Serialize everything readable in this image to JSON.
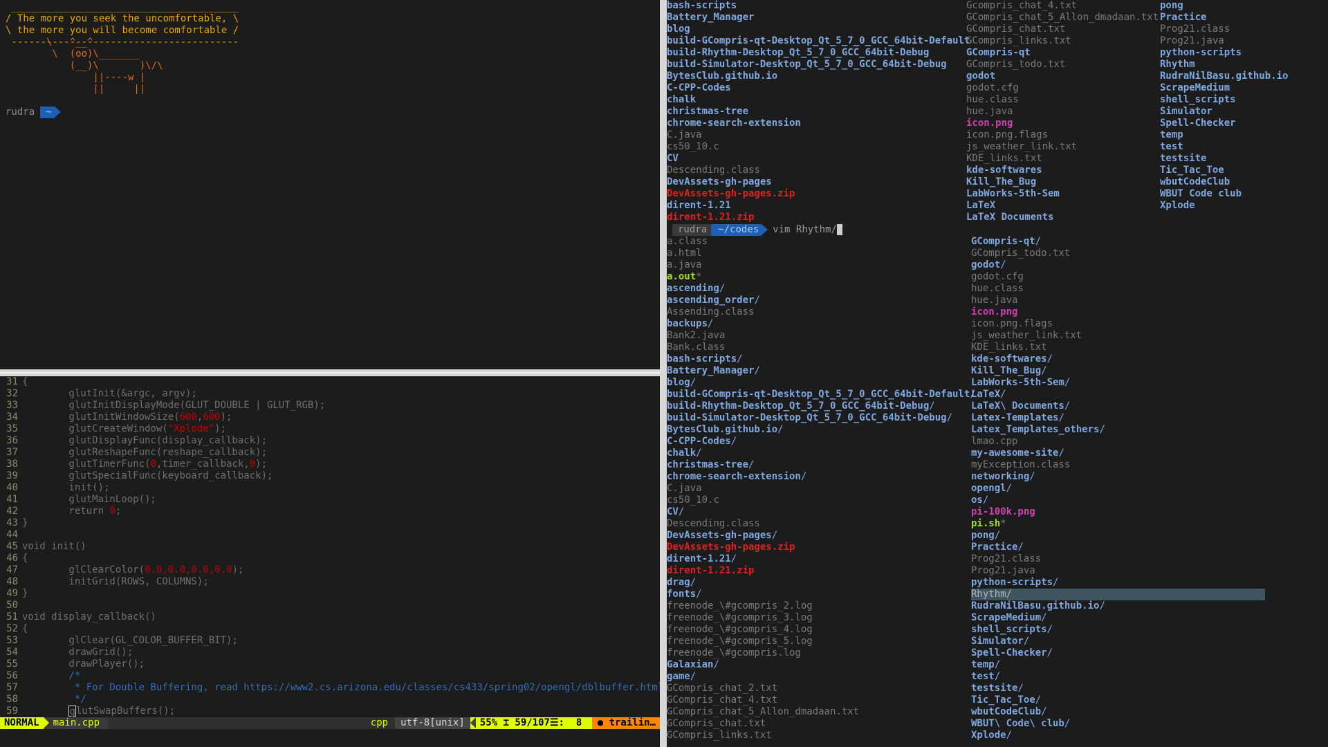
{
  "cowsay": {
    "bubble": [
      " _______________________________________",
      "/ The more you seek the uncomfortable, \\",
      "\\ the more you will become comfortable /",
      " ---------------------------------------"
    ],
    "cow": [
      "       \\   ^__^",
      "        \\  (oo)\\_______",
      "           (__)\\       )\\/\\",
      "               ||----w |",
      "               ||     ||"
    ],
    "prompt_user": "rudra",
    "prompt_dir": "~"
  },
  "vim": {
    "lines": [
      {
        "n": "31",
        "t": "{"
      },
      {
        "n": "32",
        "t": "        glutInit(&argc, argv);"
      },
      {
        "n": "33",
        "t": "        glutInitDisplayMode(GLUT_DOUBLE | GLUT_RGB);"
      },
      {
        "n": "34",
        "pre": "        glutInitWindowSize(",
        "h1": "600",
        "mid": ",",
        "h2": "600",
        "post": ");"
      },
      {
        "n": "35",
        "pre": "        glutCreateWindow(",
        "s": "\"Xplode\"",
        "post": ");"
      },
      {
        "n": "36",
        "t": "        glutDisplayFunc(display_callback);"
      },
      {
        "n": "37",
        "t": "        glutReshapeFunc(reshape_callback);"
      },
      {
        "n": "38",
        "pre": "        glutTimerFunc(",
        "h1": "0",
        "mid": ",timer_callback,",
        "h2": "0",
        "post": ");"
      },
      {
        "n": "39",
        "t": "        glutSpecialFunc(keyboard_callback);"
      },
      {
        "n": "40",
        "t": "        init();"
      },
      {
        "n": "41",
        "t": "        glutMainLoop();"
      },
      {
        "n": "42",
        "pre": "        return ",
        "h1": "0",
        "post": ";"
      },
      {
        "n": "43",
        "t": "}"
      },
      {
        "n": "44",
        "t": ""
      },
      {
        "n": "45",
        "t": "void init()"
      },
      {
        "n": "46",
        "t": "{"
      },
      {
        "n": "47",
        "pre": "        glClearColor(",
        "h1": "0.0,0.0,0.0,0.0",
        "post": ");"
      },
      {
        "n": "48",
        "t": "        initGrid(ROWS, COLUMNS);"
      },
      {
        "n": "49",
        "t": "}"
      },
      {
        "n": "50",
        "t": ""
      },
      {
        "n": "51",
        "t": "void display_callback()"
      },
      {
        "n": "52",
        "t": "{"
      },
      {
        "n": "53",
        "t": "        glClear(GL_COLOR_BUFFER_BIT);"
      },
      {
        "n": "54",
        "t": "        drawGrid();"
      },
      {
        "n": "55",
        "t": "        drawPlayer();"
      },
      {
        "n": "56",
        "c": "        /*"
      },
      {
        "n": "57",
        "c": "         * For Double Buffering, read https://www2.cs.arizona.edu/classes/cs433/spring02/opengl/dblbuffer.html"
      },
      {
        "n": "58",
        "c": "         */"
      },
      {
        "n": "59",
        "cur": true,
        "t": "glutSwapBuffers();"
      }
    ],
    "status": {
      "mode": "NORMAL",
      "file": "main.cpp",
      "filetype": "cpp",
      "encoding": "utf-8[unix]",
      "percent": "55%",
      "position": "59/107",
      "col": ":  8",
      "warning": "trailin…"
    }
  },
  "listing_top": {
    "col1": [
      {
        "n": "bash-scripts",
        "k": "dir"
      },
      {
        "n": "Battery_Manager",
        "k": "dir"
      },
      {
        "n": "blog",
        "k": "dir"
      },
      {
        "n": "build-GCompris-qt-Desktop_Qt_5_7_0_GCC_64bit-Default",
        "k": "dir"
      },
      {
        "n": "build-Rhythm-Desktop_Qt_5_7_0_GCC_64bit-Debug",
        "k": "dir"
      },
      {
        "n": "build-Simulator-Desktop_Qt_5_7_0_GCC_64bit-Debug",
        "k": "dir"
      },
      {
        "n": "BytesClub.github.io",
        "k": "dir"
      },
      {
        "n": "C-CPP-Codes",
        "k": "dir"
      },
      {
        "n": "chalk",
        "k": "dir"
      },
      {
        "n": "christmas-tree",
        "k": "dir"
      },
      {
        "n": "chrome-search-extension",
        "k": "dir"
      },
      {
        "n": "C.java",
        "k": "file"
      },
      {
        "n": "cs50_10.c",
        "k": "file"
      },
      {
        "n": "CV",
        "k": "dir"
      },
      {
        "n": "Descending.class",
        "k": "file"
      },
      {
        "n": "DevAssets-gh-pages",
        "k": "dir"
      },
      {
        "n": "DevAssets-gh-pages.zip",
        "k": "zip"
      },
      {
        "n": "dirent-1.21",
        "k": "dir"
      },
      {
        "n": "dirent-1.21.zip",
        "k": "zip"
      }
    ],
    "col2": [
      {
        "n": "Gcompris_chat_4.txt",
        "k": "file"
      },
      {
        "n": "GCompris_chat_5_Allon_dmadaan.txt",
        "k": "file"
      },
      {
        "n": "GCompris_chat.txt",
        "k": "file"
      },
      {
        "n": "GCompris_links.txt",
        "k": "file"
      },
      {
        "n": "GCompris-qt",
        "k": "dir"
      },
      {
        "n": "GCompris_todo.txt",
        "k": "file"
      },
      {
        "n": "godot",
        "k": "dir"
      },
      {
        "n": "godot.cfg",
        "k": "file"
      },
      {
        "n": "hue.class",
        "k": "file"
      },
      {
        "n": "hue.java",
        "k": "file"
      },
      {
        "n": "icon.png",
        "k": "img"
      },
      {
        "n": "icon.png.flags",
        "k": "file"
      },
      {
        "n": "js_weather_link.txt",
        "k": "file"
      },
      {
        "n": "KDE_links.txt",
        "k": "file"
      },
      {
        "n": "kde-softwares",
        "k": "dir"
      },
      {
        "n": "Kill_The_Bug",
        "k": "dir"
      },
      {
        "n": "LabWorks-5th-Sem",
        "k": "dir"
      },
      {
        "n": "LaTeX",
        "k": "dir"
      },
      {
        "n": "LaTeX Documents",
        "k": "dir"
      }
    ],
    "col3": [
      {
        "n": "pong",
        "k": "dir"
      },
      {
        "n": "Practice",
        "k": "dir"
      },
      {
        "n": "Prog21.class",
        "k": "file"
      },
      {
        "n": "Prog21.java",
        "k": "file"
      },
      {
        "n": "python-scripts",
        "k": "dir"
      },
      {
        "n": "Rhythm",
        "k": "dir"
      },
      {
        "n": "RudraNilBasu.github.io",
        "k": "dir"
      },
      {
        "n": "ScrapeMedium",
        "k": "dir"
      },
      {
        "n": "shell_scripts",
        "k": "dir"
      },
      {
        "n": "Simulator",
        "k": "dir"
      },
      {
        "n": "Spell-Checker",
        "k": "dir"
      },
      {
        "n": "temp",
        "k": "dir"
      },
      {
        "n": "test",
        "k": "dir"
      },
      {
        "n": "testsite",
        "k": "dir"
      },
      {
        "n": "Tic_Tac_Toe",
        "k": "dir"
      },
      {
        "n": "wbutCodeClub",
        "k": "dir"
      },
      {
        "n": "WBUT Code club",
        "k": "dir"
      },
      {
        "n": "Xplode",
        "k": "dir"
      }
    ]
  },
  "prompt2": {
    "user": "rudra",
    "dir": "~/codes",
    "cmd": "vim Rhythm/"
  },
  "listing_bottom": {
    "col1": [
      {
        "n": "a.class",
        "k": "file"
      },
      {
        "n": "a.html",
        "k": "file"
      },
      {
        "n": "a.java",
        "k": "file"
      },
      {
        "n": "a.out",
        "k": "exe",
        "s": "*"
      },
      {
        "n": "ascending",
        "k": "dir",
        "s": "/"
      },
      {
        "n": "ascending_order",
        "k": "dir",
        "s": "/"
      },
      {
        "n": "Assending.class",
        "k": "file"
      },
      {
        "n": "backups",
        "k": "dir",
        "s": "/"
      },
      {
        "n": "Bank2.java",
        "k": "file"
      },
      {
        "n": "Bank.class",
        "k": "file"
      },
      {
        "n": "bash-scripts",
        "k": "dir",
        "s": "/"
      },
      {
        "n": "Battery_Manager",
        "k": "dir",
        "s": "/"
      },
      {
        "n": "blog",
        "k": "dir",
        "s": "/"
      },
      {
        "n": "build-GCompris-qt-Desktop_Qt_5_7_0_GCC_64bit-Default",
        "k": "dir",
        "s": "/"
      },
      {
        "n": "build-Rhythm-Desktop_Qt_5_7_0_GCC_64bit-Debug",
        "k": "dir",
        "s": "/"
      },
      {
        "n": "build-Simulator-Desktop_Qt_5_7_0_GCC_64bit-Debug",
        "k": "dir",
        "s": "/"
      },
      {
        "n": "BytesClub.github.io",
        "k": "dir",
        "s": "/"
      },
      {
        "n": "C-CPP-Codes",
        "k": "dir",
        "s": "/"
      },
      {
        "n": "chalk",
        "k": "dir",
        "s": "/"
      },
      {
        "n": "christmas-tree",
        "k": "dir",
        "s": "/"
      },
      {
        "n": "chrome-search-extension",
        "k": "dir",
        "s": "/"
      },
      {
        "n": "C.java",
        "k": "file"
      },
      {
        "n": "cs50_10.c",
        "k": "file"
      },
      {
        "n": "CV",
        "k": "dir",
        "s": "/"
      },
      {
        "n": "Descending.class",
        "k": "file"
      },
      {
        "n": "DevAssets-gh-pages",
        "k": "dir",
        "s": "/"
      },
      {
        "n": "DevAssets-gh-pages.zip",
        "k": "zip"
      },
      {
        "n": "dirent-1.21",
        "k": "dir",
        "s": "/"
      },
      {
        "n": "dirent-1.21.zip",
        "k": "zip"
      },
      {
        "n": "drag",
        "k": "dir",
        "s": "/"
      },
      {
        "n": "fonts",
        "k": "dir",
        "s": "/"
      },
      {
        "n": "freenode_\\#gcompris_2.log",
        "k": "file"
      },
      {
        "n": "freenode_\\#gcompris_3.log",
        "k": "file"
      },
      {
        "n": "freenode_\\#gcompris_4.log",
        "k": "file"
      },
      {
        "n": "freenode_\\#gcompris_5.log",
        "k": "file"
      },
      {
        "n": "freenode_\\#gcompris.log",
        "k": "file"
      },
      {
        "n": "Galaxian",
        "k": "dir",
        "s": "/"
      },
      {
        "n": "game",
        "k": "dir",
        "s": "/"
      },
      {
        "n": "GCompris_chat_2.txt",
        "k": "file"
      },
      {
        "n": "GCompris_chat_4.txt",
        "k": "file"
      },
      {
        "n": "GCompris_chat_5_Allon_dmadaan.txt",
        "k": "file"
      },
      {
        "n": "GCompris_chat.txt",
        "k": "file"
      },
      {
        "n": "GCompris_links.txt",
        "k": "file"
      }
    ],
    "col2": [
      {
        "n": "GCompris-qt",
        "k": "dir",
        "s": "/"
      },
      {
        "n": "GCompris_todo.txt",
        "k": "file"
      },
      {
        "n": "godot",
        "k": "dir",
        "s": "/"
      },
      {
        "n": "godot.cfg",
        "k": "file"
      },
      {
        "n": "hue.class",
        "k": "file"
      },
      {
        "n": "hue.java",
        "k": "file"
      },
      {
        "n": "icon.png",
        "k": "img"
      },
      {
        "n": "icon.png.flags",
        "k": "file"
      },
      {
        "n": "js_weather_link.txt",
        "k": "file"
      },
      {
        "n": "KDE_links.txt",
        "k": "file"
      },
      {
        "n": "kde-softwares",
        "k": "dir",
        "s": "/"
      },
      {
        "n": "Kill_The_Bug",
        "k": "dir",
        "s": "/"
      },
      {
        "n": "LabWorks-5th-Sem",
        "k": "dir",
        "s": "/"
      },
      {
        "n": "LaTeX",
        "k": "dir",
        "s": "/"
      },
      {
        "n": "LaTeX\\ Documents",
        "k": "dir",
        "s": "/"
      },
      {
        "n": "Latex-Templates",
        "k": "dir",
        "s": "/"
      },
      {
        "n": "Latex_Templates_others",
        "k": "dir",
        "s": "/"
      },
      {
        "n": "lmao.cpp",
        "k": "file"
      },
      {
        "n": "my-awesome-site",
        "k": "dir",
        "s": "/"
      },
      {
        "n": "myException.class",
        "k": "file"
      },
      {
        "n": "networking",
        "k": "dir",
        "s": "/"
      },
      {
        "n": "opengl",
        "k": "dir",
        "s": "/"
      },
      {
        "n": "os",
        "k": "dir",
        "s": "/"
      },
      {
        "n": "pi-100k.png",
        "k": "img"
      },
      {
        "n": "pi.sh",
        "k": "exe",
        "s": "*"
      },
      {
        "n": "pong",
        "k": "dir",
        "s": "/"
      },
      {
        "n": "Practice",
        "k": "dir",
        "s": "/"
      },
      {
        "n": "Prog21.class",
        "k": "file"
      },
      {
        "n": "Prog21.java",
        "k": "file"
      },
      {
        "n": "python-scripts",
        "k": "dir",
        "s": "/"
      },
      {
        "n": "Rhythm/",
        "k": "sel"
      },
      {
        "n": "RudraNilBasu.github.io",
        "k": "dir",
        "s": "/"
      },
      {
        "n": "ScrapeMedium",
        "k": "dir",
        "s": "/"
      },
      {
        "n": "shell_scripts",
        "k": "dir",
        "s": "/"
      },
      {
        "n": "Simulator",
        "k": "dir",
        "s": "/"
      },
      {
        "n": "Spell-Checker",
        "k": "dir",
        "s": "/"
      },
      {
        "n": "temp",
        "k": "dir",
        "s": "/"
      },
      {
        "n": "test",
        "k": "dir",
        "s": "/"
      },
      {
        "n": "testsite",
        "k": "dir",
        "s": "/"
      },
      {
        "n": "Tic_Tac_Toe",
        "k": "dir",
        "s": "/"
      },
      {
        "n": "wbutCodeClub",
        "k": "dir",
        "s": "/"
      },
      {
        "n": "WBUT\\ Code\\ club",
        "k": "dir",
        "s": "/"
      },
      {
        "n": "Xplode",
        "k": "dir",
        "s": "/"
      }
    ]
  }
}
